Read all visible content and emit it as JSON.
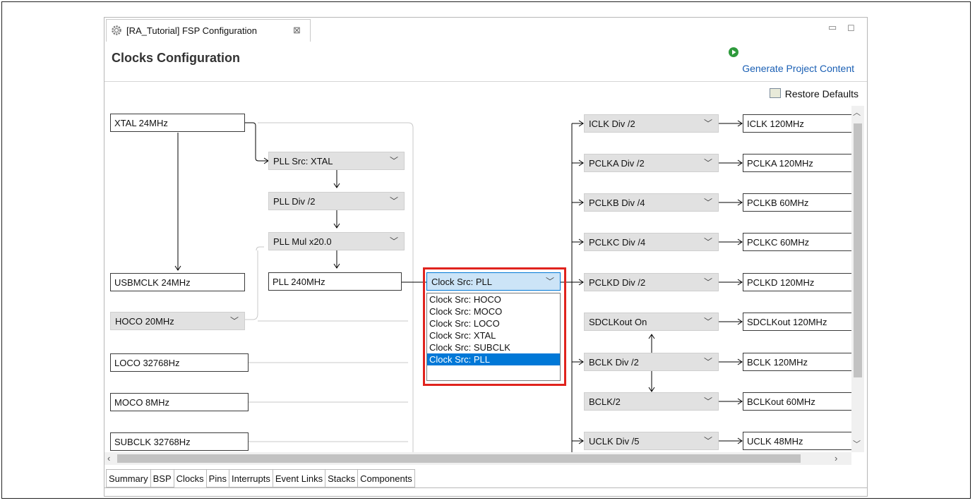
{
  "window": {
    "tab_title": "[RA_Tutorial] FSP Configuration",
    "tab_close_glyph": "⊠",
    "minimize_glyph": "▭",
    "maximize_glyph": "◻"
  },
  "header": {
    "title": "Clocks Configuration",
    "generate_label": "Generate Project Content",
    "restore_label": "Restore Defaults"
  },
  "sources": {
    "xtal": "XTAL 24MHz",
    "usbmclk": "USBMCLK 24MHz",
    "hoco": "HOCO 20MHz",
    "loco": "LOCO 32768Hz",
    "moco": "MOCO 8MHz",
    "subclk": "SUBCLK 32768Hz"
  },
  "pll": {
    "src": "PLL Src: XTAL",
    "div": "PLL Div /2",
    "mul": "PLL Mul x20.0",
    "out": "PLL 240MHz"
  },
  "clock_src": {
    "selected": "Clock Src: PLL",
    "options": [
      "Clock Src: HOCO",
      "Clock Src: MOCO",
      "Clock Src: LOCO",
      "Clock Src: XTAL",
      "Clock Src: SUBCLK",
      "Clock Src: PLL"
    ],
    "highlighted_index": 5
  },
  "dividers": [
    {
      "select": "ICLK Div /2",
      "output": "ICLK 120MHz"
    },
    {
      "select": "PCLKA Div /2",
      "output": "PCLKA 120MHz"
    },
    {
      "select": "PCLKB Div /4",
      "output": "PCLKB 60MHz"
    },
    {
      "select": "PCLKC Div /4",
      "output": "PCLKC 60MHz"
    },
    {
      "select": "PCLKD Div /2",
      "output": "PCLKD 120MHz"
    },
    {
      "select": "SDCLKout On",
      "output": "SDCLKout 120MHz"
    },
    {
      "select": "BCLK Div /2",
      "output": "BCLK 120MHz"
    },
    {
      "select": "BCLK/2",
      "output": "BCLKout 60MHz"
    },
    {
      "select": "UCLK Div /5",
      "output": "UCLK 48MHz"
    }
  ],
  "bottom_tabs": [
    "Summary",
    "BSP",
    "Clocks",
    "Pins",
    "Interrupts",
    "Event Links",
    "Stacks",
    "Components"
  ],
  "active_tab": "Clocks",
  "colors": {
    "highlight_border": "#e0231d",
    "selection": "#0078d7",
    "link": "#1a5fb4",
    "select_bg": "#e1e1e1"
  },
  "icons": {
    "tab": "gear-icon",
    "generate": "green-play-icon",
    "restore": "restore-defaults-icon"
  }
}
